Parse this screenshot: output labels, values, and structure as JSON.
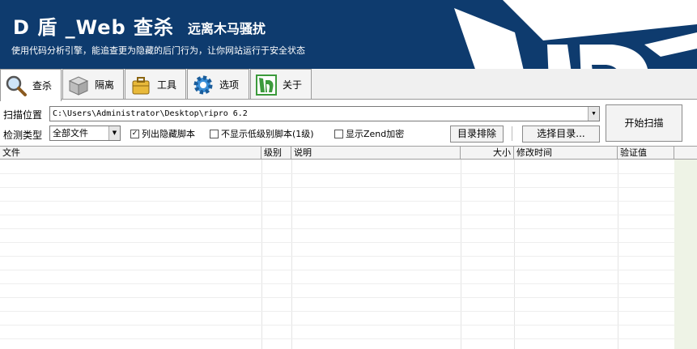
{
  "banner": {
    "title": "D 盾 _Web 查杀",
    "subtitle": "远离木马骚扰",
    "description": "使用代码分析引擎，能追查更为隐藏的后门行为，让你网站运行于安全状态",
    "logo_icon": "d-shield-logo-icon"
  },
  "tabs": [
    {
      "label": "查杀",
      "icon": "magnifier-icon",
      "active": true
    },
    {
      "label": "隔离",
      "icon": "box-icon",
      "active": false
    },
    {
      "label": "工具",
      "icon": "toolbox-icon",
      "active": false
    },
    {
      "label": "选项",
      "icon": "gear-icon",
      "active": false
    },
    {
      "label": "关于",
      "icon": "d-logo-icon",
      "active": false
    }
  ],
  "scan": {
    "location_label": "扫描位置",
    "path_value": "C:\\Users\\Administrator\\Desktop\\ripro 6.2",
    "type_label": "检测类型",
    "type_value": "全部文件",
    "checkbox_hidden": {
      "label": "列出隐藏脚本",
      "checked": true
    },
    "checkbox_lowlevel": {
      "label": "不显示低级别脚本(1级)",
      "checked": false
    },
    "checkbox_zend": {
      "label": "显示Zend加密",
      "checked": false
    },
    "start_button": "开始扫描",
    "exclude_button": "目录排除",
    "choose_button": "选择目录..."
  },
  "grid": {
    "columns": [
      "文件",
      "级别",
      "说明",
      "大小",
      "修改时间",
      "验证值"
    ]
  },
  "colors": {
    "banner_bg": "#0e3b6e",
    "accent_green": "#3c9a3c"
  }
}
